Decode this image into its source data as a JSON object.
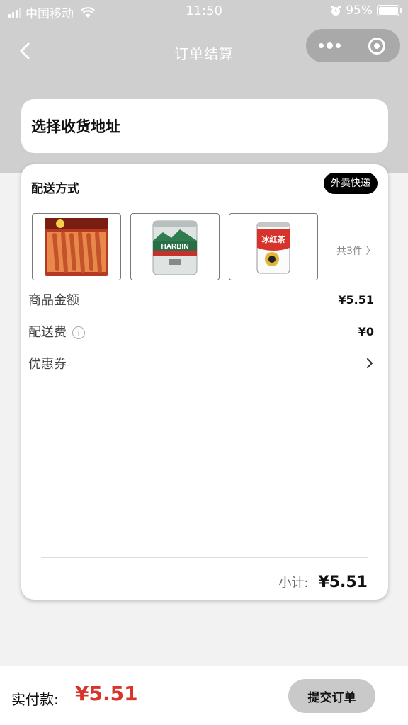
{
  "status_bar": {
    "carrier": "中国移动",
    "time": "11:50",
    "battery": "95%"
  },
  "nav": {
    "title": "订单结算"
  },
  "address": {
    "label": "选择收货地址"
  },
  "delivery": {
    "title": "配送方式",
    "badge": "外卖快递",
    "product_count": "共3件 〉",
    "products": [
      {
        "name": "spicy-strips-snack"
      },
      {
        "name": "harbin-beer-can",
        "brand": "HARBIN"
      },
      {
        "name": "iced-tea-can",
        "brand": "冰红茶"
      }
    ]
  },
  "summary": {
    "goods_label": "商品金额",
    "goods_value": "¥5.51",
    "shipping_label": "配送费",
    "shipping_value": "¥0",
    "coupon_label": "优惠券",
    "subtotal_label": "小计:",
    "subtotal_value": "¥5.51"
  },
  "footer": {
    "pay_label": "实付款:",
    "pay_amount": "¥5.51",
    "submit": "提交订单"
  },
  "colors": {
    "accent_price": "#d9342b",
    "header_bg": "#cfcfcf"
  }
}
